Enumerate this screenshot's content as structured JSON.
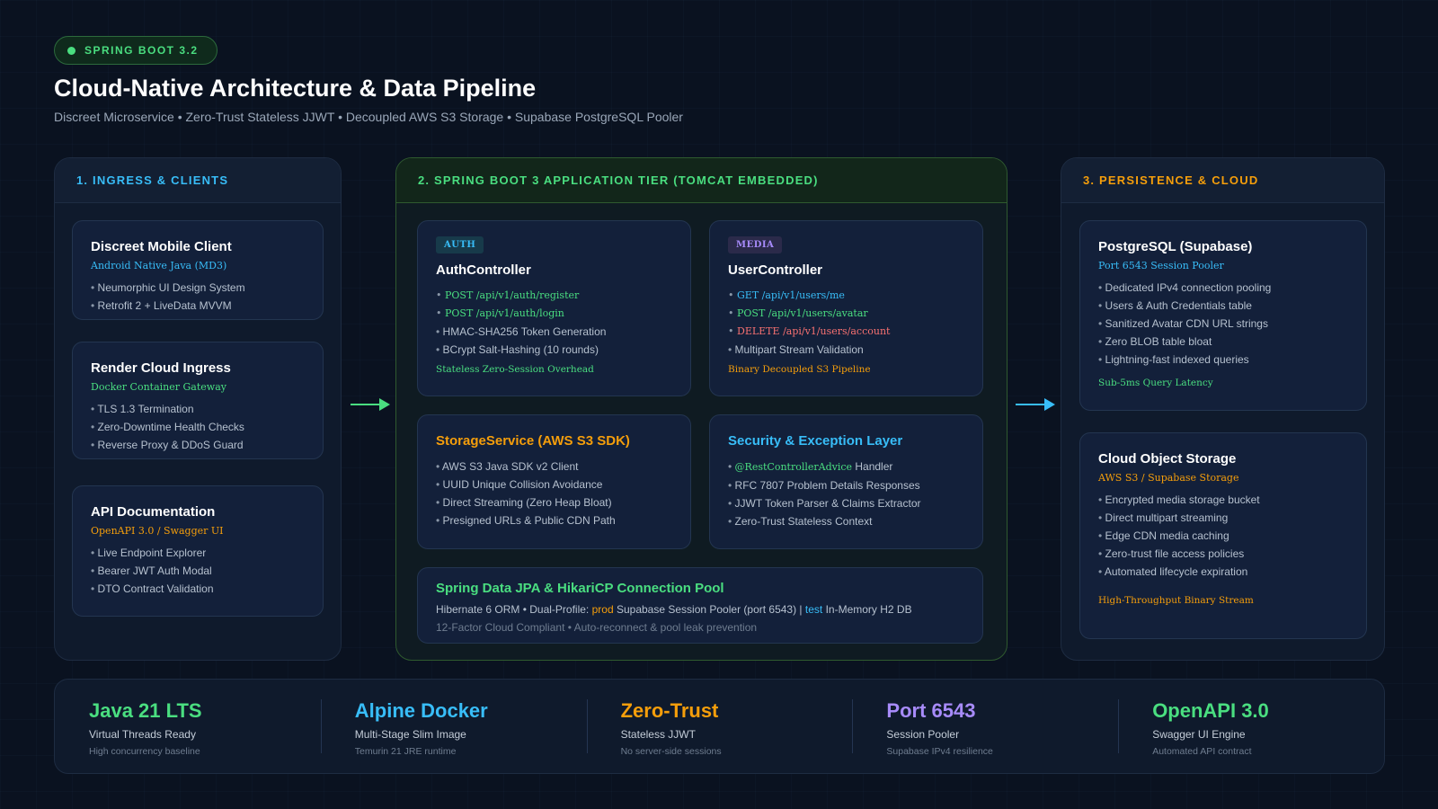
{
  "header": {
    "badge": "SPRING BOOT 3.2",
    "title": "Cloud-Native Architecture & Data Pipeline",
    "subtitle": "Discreet Microservice • Zero-Trust Stateless JJWT • Decoupled AWS S3 Storage • Supabase PostgreSQL Pooler"
  },
  "colors": {
    "green": "#4ade80",
    "blue": "#38bdf8",
    "orange": "#f59e0b",
    "purple": "#a78bfa",
    "red": "#f87171"
  },
  "ingress": {
    "heading": "1. INGRESS & CLIENTS",
    "cards": [
      {
        "title": "Discreet Mobile Client",
        "sub": "Android Native Java (MD3)",
        "bullets": [
          "Neumorphic UI Design System",
          "Retrofit 2 + LiveData MVVM"
        ]
      },
      {
        "title": "Render Cloud Ingress",
        "sub": "Docker Container Gateway",
        "bullets": [
          "TLS 1.3 Termination",
          "Zero-Downtime Health Checks",
          "Reverse Proxy & DDoS Guard"
        ]
      },
      {
        "title": "API Documentation",
        "sub": "OpenAPI 3.0 / Swagger UI",
        "bullets": [
          "Live Endpoint Explorer",
          "Bearer JWT Auth Modal",
          "DTO Contract Validation"
        ]
      }
    ]
  },
  "app": {
    "heading": "2. SPRING BOOT 3 APPLICATION TIER (TOMCAT EMBEDDED)",
    "auth": {
      "tag": "AUTH",
      "title": "AuthController",
      "endpoints": [
        {
          "method": "POST",
          "path": "/api/v1/auth/register"
        },
        {
          "method": "POST",
          "path": "/api/v1/auth/login"
        }
      ],
      "bullets": [
        "HMAC-SHA256 Token Generation",
        "BCrypt Salt-Hashing (10 rounds)"
      ],
      "note": "Stateless Zero-Session Overhead"
    },
    "user": {
      "tag": "MEDIA",
      "title": "UserController",
      "endpoints": [
        {
          "method": "GET",
          "path": "/api/v1/users/me"
        },
        {
          "method": "POST",
          "path": "/api/v1/users/avatar"
        },
        {
          "method": "DELETE",
          "path": "/api/v1/users/account"
        }
      ],
      "bullets": [
        "Multipart Stream Validation"
      ],
      "note": "Binary Decoupled S3 Pipeline"
    },
    "storage": {
      "title": "StorageService (AWS S3 SDK)",
      "bullets": [
        "AWS S3 Java SDK v2 Client",
        "UUID Unique Collision Avoidance",
        "Direct Streaming (Zero Heap Bloat)",
        "Presigned URLs & Public CDN Path"
      ]
    },
    "security": {
      "title": "Security & Exception Layer",
      "advice_code": "@RestControllerAdvice",
      "advice_text": " Handler",
      "bullets": [
        "RFC 7807 Problem Details Responses",
        "JJWT Token Parser & Claims Extractor",
        "Zero-Trust Stateless Context"
      ]
    },
    "jpa": {
      "title": "Spring Data JPA & HikariCP Connection Pool",
      "line1_a": "Hibernate 6 ORM • Dual-Profile: ",
      "prod": "prod",
      "line1_b": " Supabase Session Pooler (port 6543) | ",
      "test": "test",
      "line1_c": " In-Memory H2 DB",
      "line2": "12-Factor Cloud Compliant • Auto-reconnect & pool leak prevention"
    }
  },
  "persist": {
    "heading": "3. PERSISTENCE & CLOUD",
    "postgres": {
      "title": "PostgreSQL (Supabase)",
      "sub": "Port 6543 Session Pooler",
      "bullets": [
        "Dedicated IPv4 connection pooling",
        "Users & Auth Credentials table",
        "Sanitized Avatar CDN URL strings",
        "Zero BLOB table bloat",
        "Lightning-fast indexed queries"
      ],
      "note": "Sub-5ms Query Latency"
    },
    "object": {
      "title": "Cloud Object Storage",
      "sub": "AWS S3 / Supabase Storage",
      "bullets": [
        "Encrypted media storage bucket",
        "Direct multipart streaming",
        "Edge CDN media caching",
        "Zero-trust file access policies",
        "Automated lifecycle expiration"
      ],
      "note": "High-Throughput Binary Stream"
    }
  },
  "stats": [
    {
      "value": "Java 21 LTS",
      "label": "Virtual Threads Ready",
      "note": "High concurrency baseline",
      "color": "#4ade80"
    },
    {
      "value": "Alpine Docker",
      "label": "Multi-Stage Slim Image",
      "note": "Temurin 21 JRE runtime",
      "color": "#38bdf8"
    },
    {
      "value": "Zero-Trust",
      "label": "Stateless JJWT",
      "note": "No server-side sessions",
      "color": "#f59e0b"
    },
    {
      "value": "Port 6543",
      "label": "Session Pooler",
      "note": "Supabase IPv4 resilience",
      "color": "#a78bfa"
    },
    {
      "value": "OpenAPI 3.0",
      "label": "Swagger UI Engine",
      "note": "Automated API contract",
      "color": "#4ade80"
    }
  ]
}
